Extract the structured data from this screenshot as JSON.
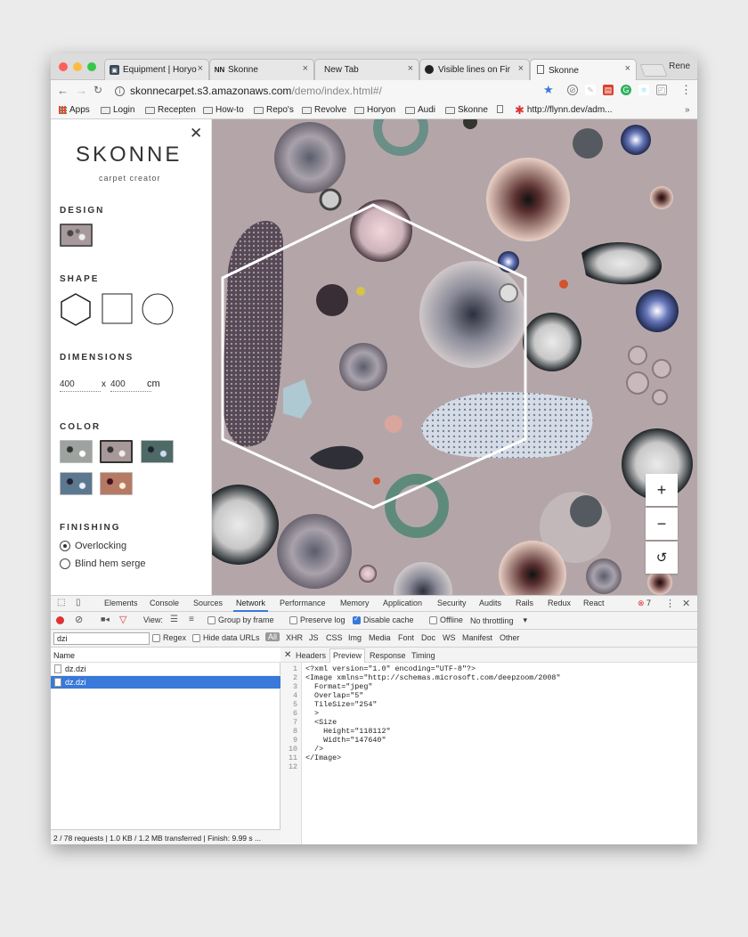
{
  "browser": {
    "tabs": [
      {
        "label": "Equipment | Horyo",
        "icon": "horyon-favicon-icon"
      },
      {
        "label": "Skonne",
        "icon": "skonne-favicon-icon"
      },
      {
        "label": "New Tab",
        "icon": ""
      },
      {
        "label": "Visible lines on Fir",
        "icon": "github-icon"
      },
      {
        "label": "Skonne",
        "icon": "document-icon"
      }
    ],
    "user": "Rene",
    "url_host": "skonnecarpet.s3.amazonaws.com",
    "url_path": "/demo/index.html#/",
    "bookmarks": [
      "Apps",
      "Login",
      "Recepten",
      "How-to",
      "Repo's",
      "Revolve",
      "Horyon",
      "Audi",
      "Skonne",
      "http://flynn.dev/adm..."
    ]
  },
  "app": {
    "logo": "SKONNE",
    "tagline": "carpet creator",
    "sections": {
      "design": "DESIGN",
      "shape": "SHAPE",
      "dimensions": "DIMENSIONS",
      "color": "COLOR",
      "finishing": "FINISHING"
    },
    "dimensions": {
      "width": "400",
      "separator": "x",
      "height": "400",
      "unit": "cm"
    },
    "finishing_options": [
      "Overlocking",
      "Blind hem serge"
    ],
    "finishing_selected": "Overlocking",
    "selected_shape": "hexagon",
    "zoom_in": "+",
    "zoom_out": "−",
    "reset": "↺"
  },
  "devtools": {
    "tabs": [
      "Elements",
      "Console",
      "Sources",
      "Network",
      "Performance",
      "Memory",
      "Application",
      "Security",
      "Audits",
      "Rails",
      "Redux",
      "React"
    ],
    "active_tab": "Network",
    "error_count": "7",
    "view_label": "View:",
    "group_by_frame": "Group by frame",
    "preserve_log": "Preserve log",
    "disable_cache": "Disable cache",
    "offline": "Offline",
    "throttling": "No throttling",
    "filter_value": "dzi",
    "regex": "Regex",
    "hide_data_urls": "Hide data URLs",
    "type_filters": [
      "All",
      "XHR",
      "JS",
      "CSS",
      "Img",
      "Media",
      "Font",
      "Doc",
      "WS",
      "Manifest",
      "Other"
    ],
    "name_header": "Name",
    "requests": [
      "dz.dzi",
      "dz.dzi"
    ],
    "status_bar": "2 / 78 requests | 1.0 KB / 1.2 MB transferred | Finish: 9.99 s ...",
    "detail_tabs": [
      "Headers",
      "Preview",
      "Response",
      "Timing"
    ],
    "active_detail_tab": "Preview",
    "code_lines": [
      "<?xml version=\"1.0\" encoding=\"UTF-8\"?>",
      "<Image xmlns=\"http://schemas.microsoft.com/deepzoom/2008\"",
      "  Format=\"jpeg\"",
      "  Overlap=\"5\"",
      "  TileSize=\"254\"",
      "  >",
      "  <Size",
      "    Height=\"118112\"",
      "    Width=\"147640\"",
      "  />",
      "</Image>",
      ""
    ]
  }
}
